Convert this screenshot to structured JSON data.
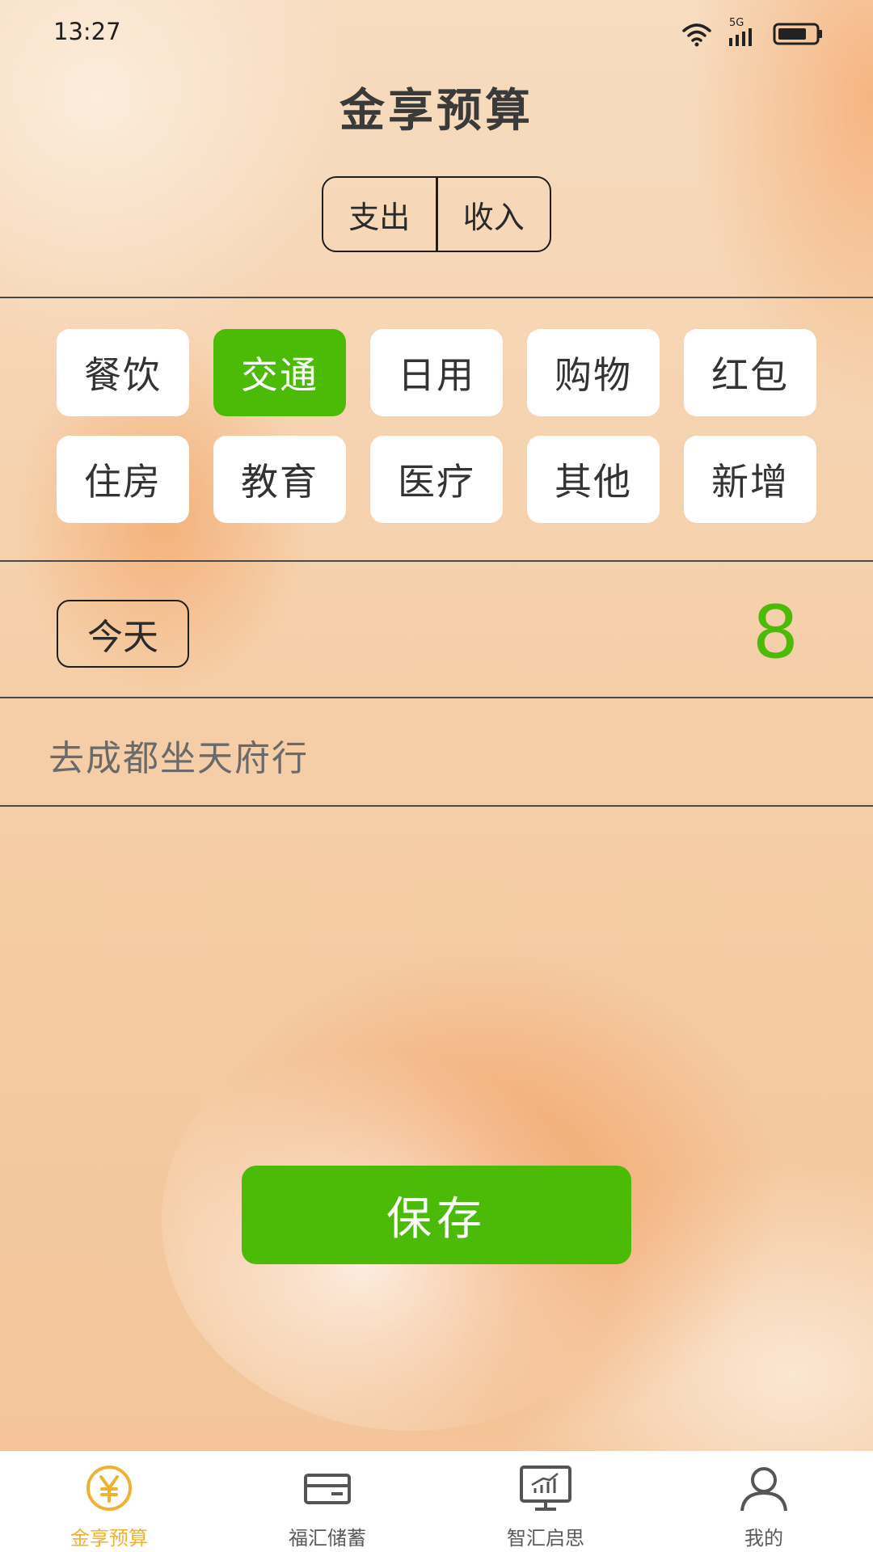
{
  "status_bar": {
    "time": "13:27",
    "network": "5G"
  },
  "header": {
    "title": "金享预算"
  },
  "type_toggle": {
    "options": [
      {
        "label": "支出"
      },
      {
        "label": "收入"
      }
    ]
  },
  "categories": {
    "items": [
      {
        "label": "餐饮",
        "selected": false
      },
      {
        "label": "交通",
        "selected": true
      },
      {
        "label": "日用",
        "selected": false
      },
      {
        "label": "购物",
        "selected": false
      },
      {
        "label": "红包",
        "selected": false
      },
      {
        "label": "住房",
        "selected": false
      },
      {
        "label": "教育",
        "selected": false
      },
      {
        "label": "医疗",
        "selected": false
      },
      {
        "label": "其他",
        "selected": false
      },
      {
        "label": "新增",
        "selected": false
      }
    ]
  },
  "entry": {
    "date_label": "今天",
    "amount": "8",
    "note": "去成都坐天府行"
  },
  "actions": {
    "save_label": "保存"
  },
  "tabbar": {
    "items": [
      {
        "label": "金享预算",
        "icon": "yen-circle-icon",
        "active": true
      },
      {
        "label": "福汇储蓄",
        "icon": "card-icon",
        "active": false
      },
      {
        "label": "智汇启思",
        "icon": "chart-monitor-icon",
        "active": false
      },
      {
        "label": "我的",
        "icon": "user-icon",
        "active": false
      }
    ]
  },
  "colors": {
    "accent_green": "#4cbb08",
    "active_tab": "#f0b12f",
    "background": "#f6d2ad"
  }
}
